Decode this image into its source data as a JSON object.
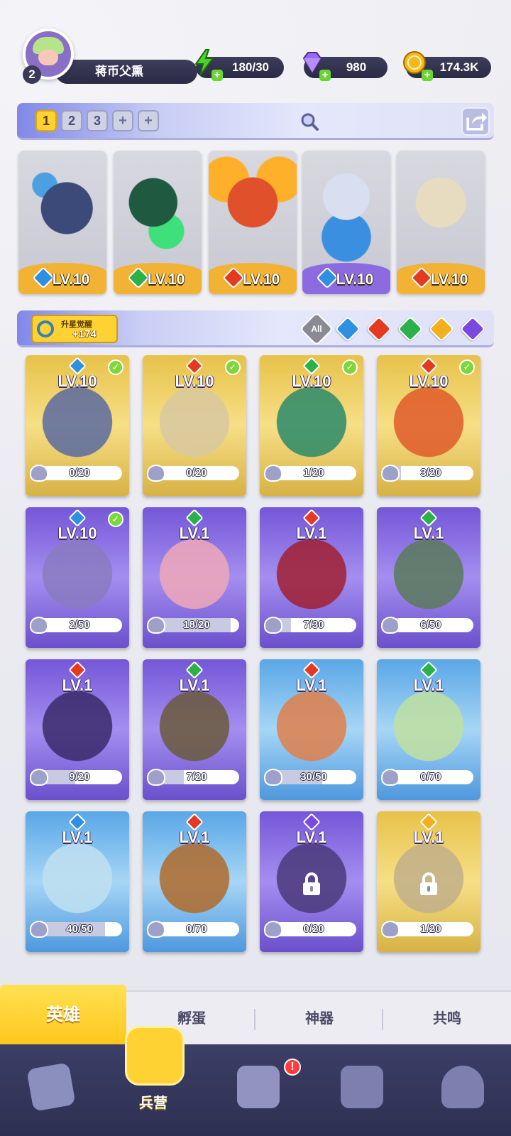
{
  "player": {
    "level": "2",
    "name": "蒋币父熏"
  },
  "resources": {
    "energy": {
      "value": "180/30",
      "icon": "lightning-icon",
      "color": "#4fd12a"
    },
    "gems": {
      "value": "980",
      "icon": "diamond-icon",
      "color": "#9a6af0"
    },
    "coins": {
      "value": "174.3K",
      "icon": "coin-icon",
      "color": "#f5b81c"
    }
  },
  "team": {
    "tabs": [
      "1",
      "2",
      "3",
      "+",
      "+"
    ],
    "active_tab": "1"
  },
  "lineup": [
    {
      "level": "LV.10",
      "element": "water",
      "selected": false,
      "art": "dark-knight-hero"
    },
    {
      "level": "LV.10",
      "element": "wind",
      "selected": false,
      "art": "green-swordswoman-hero"
    },
    {
      "level": "LV.10",
      "element": "fire",
      "selected": false,
      "art": "fire-cannon-hero"
    },
    {
      "level": "LV.10",
      "element": "water",
      "selected": true,
      "art": "pirate-hero"
    },
    {
      "level": "LV.10",
      "element": "fire",
      "selected": false,
      "art": "mummy-hero"
    }
  ],
  "awaken": {
    "label": "升星觉醒",
    "value": "+174"
  },
  "filters": [
    "All",
    "water",
    "fire",
    "wind",
    "light",
    "dark"
  ],
  "element_colors": {
    "water": "#2f8fe0",
    "fire": "#e53a22",
    "wind": "#2bb04a",
    "light": "#f2b021",
    "dark": "#7a4ae0",
    "all": "#8a8a94"
  },
  "heroes": [
    {
      "level": "LV.10",
      "element": "water",
      "progress": "0/20",
      "fraction": 0.0,
      "frame": "gold",
      "owned": true,
      "locked": false,
      "art_color": "#5a6aa0"
    },
    {
      "level": "LV.10",
      "element": "fire",
      "progress": "0/20",
      "fraction": 0.0,
      "frame": "gold",
      "owned": true,
      "locked": false,
      "art_color": "#d8c8a0"
    },
    {
      "level": "LV.10",
      "element": "wind",
      "progress": "1/20",
      "fraction": 0.05,
      "frame": "gold",
      "owned": true,
      "locked": false,
      "art_color": "#2a8a6a"
    },
    {
      "level": "LV.10",
      "element": "fire",
      "progress": "3/20",
      "fraction": 0.15,
      "frame": "gold",
      "owned": true,
      "locked": false,
      "art_color": "#e05a2a"
    },
    {
      "level": "LV.10",
      "element": "water",
      "progress": "2/50",
      "fraction": 0.04,
      "frame": "purple",
      "owned": true,
      "locked": false,
      "art_color": "#8a7ac0"
    },
    {
      "level": "LV.1",
      "element": "wind",
      "progress": "18/20",
      "fraction": 0.9,
      "frame": "purple",
      "owned": false,
      "locked": false,
      "art_color": "#f0a8b8"
    },
    {
      "level": "LV.1",
      "element": "fire",
      "progress": "7/30",
      "fraction": 0.23,
      "frame": "purple",
      "owned": false,
      "locked": false,
      "art_color": "#a02030"
    },
    {
      "level": "LV.1",
      "element": "wind",
      "progress": "6/50",
      "fraction": 0.12,
      "frame": "purple",
      "owned": false,
      "locked": false,
      "art_color": "#5a7a5a"
    },
    {
      "level": "LV.1",
      "element": "fire",
      "progress": "9/20",
      "fraction": 0.45,
      "frame": "purple",
      "owned": false,
      "locked": false,
      "art_color": "#3a2a6a"
    },
    {
      "level": "LV.1",
      "element": "wind",
      "progress": "7/20",
      "fraction": 0.35,
      "frame": "purple",
      "owned": false,
      "locked": false,
      "art_color": "#6a5a3a"
    },
    {
      "level": "LV.1",
      "element": "fire",
      "progress": "30/50",
      "fraction": 0.6,
      "frame": "blue",
      "owned": false,
      "locked": false,
      "art_color": "#e0804a"
    },
    {
      "level": "LV.1",
      "element": "wind",
      "progress": "0/70",
      "fraction": 0.0,
      "frame": "blue",
      "owned": false,
      "locked": false,
      "art_color": "#bfe0a0"
    },
    {
      "level": "LV.1",
      "element": "water",
      "progress": "40/50",
      "fraction": 0.8,
      "frame": "blue",
      "owned": false,
      "locked": false,
      "art_color": "#c0e0f0"
    },
    {
      "level": "LV.1",
      "element": "fire",
      "progress": "0/70",
      "fraction": 0.0,
      "frame": "blue",
      "owned": false,
      "locked": false,
      "art_color": "#b06a2a"
    },
    {
      "level": "LV.1",
      "element": "dark",
      "progress": "0/20",
      "fraction": 0.0,
      "frame": "purple",
      "owned": false,
      "locked": true,
      "art_color": "#4a3a7a"
    },
    {
      "level": "LV.1",
      "element": "light",
      "progress": "1/20",
      "fraction": 0.05,
      "frame": "gold",
      "owned": false,
      "locked": true,
      "art_color": "#c0b08a"
    }
  ],
  "subtabs": [
    {
      "label": "英雄",
      "active": true
    },
    {
      "label": "孵蛋",
      "active": false
    },
    {
      "label": "神器",
      "active": false
    },
    {
      "label": "共鸣",
      "active": false
    }
  ],
  "navbar": [
    {
      "icon": "cards-icon",
      "label": "",
      "active": false,
      "alert": false
    },
    {
      "icon": "barracks-icon",
      "label": "兵营",
      "active": true,
      "alert": false
    },
    {
      "icon": "map-icon",
      "label": "",
      "active": false,
      "alert": true
    },
    {
      "icon": "locked-castle-icon",
      "label": "",
      "active": false,
      "alert": false
    },
    {
      "icon": "mushroom-icon",
      "label": "",
      "active": false,
      "alert": false
    }
  ],
  "alert_mark": "!"
}
